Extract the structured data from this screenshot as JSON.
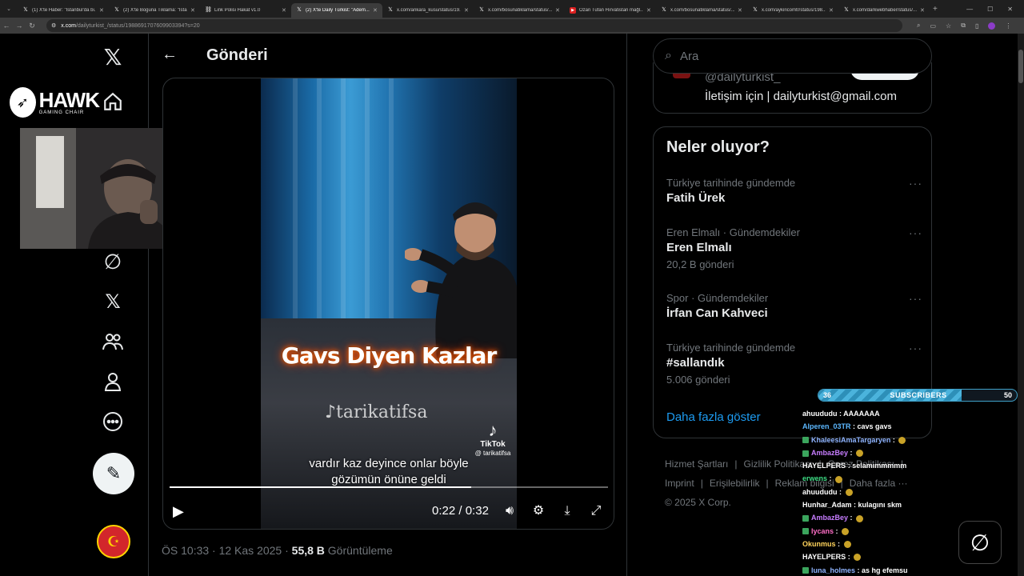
{
  "browser": {
    "tabs": [
      {
        "label": "(1) X'te Haber: \"İstanbul'da bi...",
        "favicon": "x-icon",
        "active": false
      },
      {
        "label": "(2) X'te Boguna Tıklama: \"İsta...",
        "favicon": "x-icon",
        "active": false
      },
      {
        "label": "Link Polisi Hakat v1.0",
        "favicon": "link-icon",
        "active": false
      },
      {
        "label": "(2) X'te Daily Türkist: \"Adem...",
        "favicon": "x-icon",
        "active": true
      },
      {
        "label": "x.com/ankara_kusu/status/19...",
        "favicon": "x-icon",
        "active": false
      },
      {
        "label": "x.com/bosunatiklama/status/...",
        "favicon": "x-icon",
        "active": false
      },
      {
        "label": "Ozan Tufan Hırvatistan mağl...",
        "favicon": "youtube-icon",
        "active": false
      },
      {
        "label": "x.com/bosunatiklama/status/...",
        "favicon": "x-icon",
        "active": false
      },
      {
        "label": "x.com/aykiricomtr/status/198...",
        "favicon": "x-icon",
        "active": false
      },
      {
        "label": "x.com/darkwebhaber/status/...",
        "favicon": "x-icon",
        "active": false
      }
    ],
    "url_domain": "x.com",
    "url_path": "/dailyturkist_/status/1988691707609903394?s=20"
  },
  "sidebar": {
    "brand_name": "HAWK",
    "brand_sub": "GAMING CHAIR"
  },
  "main": {
    "back_label": "←",
    "title": "Gönderi",
    "video": {
      "overlay_title": "Gavs Diyen Kazlar",
      "watermark": "tarikatifsa",
      "tiktok_label": "TikTok",
      "tiktok_handle": "@ tarikatifsa",
      "caption_line1": "vardır kaz deyince onlar böyle",
      "caption_line2": "gözümün önüne geldi",
      "progress": 0.6875,
      "time_current": "0:22",
      "time_separator": "/",
      "time_total": "0:32"
    },
    "post_time": "ÖS 10:33 · 12 Kas 2025 ·",
    "post_views": "55,8 B",
    "post_views_label": "Görüntüleme"
  },
  "right": {
    "search_placeholder": "Ara",
    "profile_handle": "@dailyturkist_",
    "profile_bio": "İletişim için | dailyturkist@gmail.com",
    "trends_title": "Neler oluyor?",
    "trends": [
      {
        "context": "Türkiye tarihinde gündemde",
        "name": "Fatih Ürek",
        "count": ""
      },
      {
        "context": "Eren Elmalı · Gündemdekiler",
        "name": "Eren Elmalı",
        "count": "20,2 B gönderi"
      },
      {
        "context": "Spor · Gündemdekiler",
        "name": "İrfan Can Kahveci",
        "count": ""
      },
      {
        "context": "Türkiye tarihinde gündemde",
        "name": "#sallandık",
        "count": "5.006 gönderi"
      }
    ],
    "more_label": "···",
    "show_more": "Daha fazla göster",
    "footer": [
      "Hizmet Şartları",
      "|",
      "Gizlilik Politikası",
      "|",
      "Çerez Politikası",
      "|",
      "Imprint",
      "|",
      "Erişilebilirlik",
      "|",
      "Reklam bilgisi",
      "|",
      "Daha fazla ···",
      "© 2025 X Corp."
    ]
  },
  "stream": {
    "subs_current": "36",
    "subs_label": "SUBSCRIBERS",
    "subs_goal": "50",
    "subs_progress": 0.72,
    "chat": [
      {
        "user": "ahuududu",
        "text": "AAAAAAA",
        "color": "#ffffff",
        "badge": false,
        "emote": false
      },
      {
        "user": "Alperen_03TR",
        "text": "cavs gavs",
        "color": "#5cb8ff",
        "badge": false,
        "emote": false
      },
      {
        "user": "KhaleesiAmaTargaryen",
        "text": "",
        "color": "#8fb4ff",
        "badge": true,
        "emote": true
      },
      {
        "user": "AmbazBey",
        "text": "",
        "color": "#c77dff",
        "badge": true,
        "emote": true
      },
      {
        "user": "HAYELPERS",
        "text": "selamımmmmm",
        "color": "#ffffff",
        "badge": false,
        "emote": false
      },
      {
        "user": "erwens",
        "text": "",
        "color": "#3ddc84",
        "badge": false,
        "emote": true
      },
      {
        "user": "ahuududu",
        "text": "",
        "color": "#ffffff",
        "badge": false,
        "emote": true
      },
      {
        "user": "Hunhar_Adam",
        "text": "kulagını skm",
        "color": "#ffffff",
        "badge": false,
        "emote": false
      },
      {
        "user": "AmbazBey",
        "text": "",
        "color": "#c77dff",
        "badge": true,
        "emote": true
      },
      {
        "user": "lycans",
        "text": "",
        "color": "#ff6ec7",
        "badge": true,
        "emote": true
      },
      {
        "user": "Okunmus",
        "text": "",
        "color": "#ffd45c",
        "badge": false,
        "emote": true
      },
      {
        "user": "HAYELPERS",
        "text": "",
        "color": "#ffffff",
        "badge": false,
        "emote": true
      },
      {
        "user": "luna_holmes",
        "text": "as hg efemsu",
        "color": "#8fb4ff",
        "badge": true,
        "emote": false
      }
    ]
  },
  "colors": {
    "accent": "#1d9bf0",
    "background": "#000000",
    "border": "#2f3336",
    "muted_text": "#71767b"
  }
}
